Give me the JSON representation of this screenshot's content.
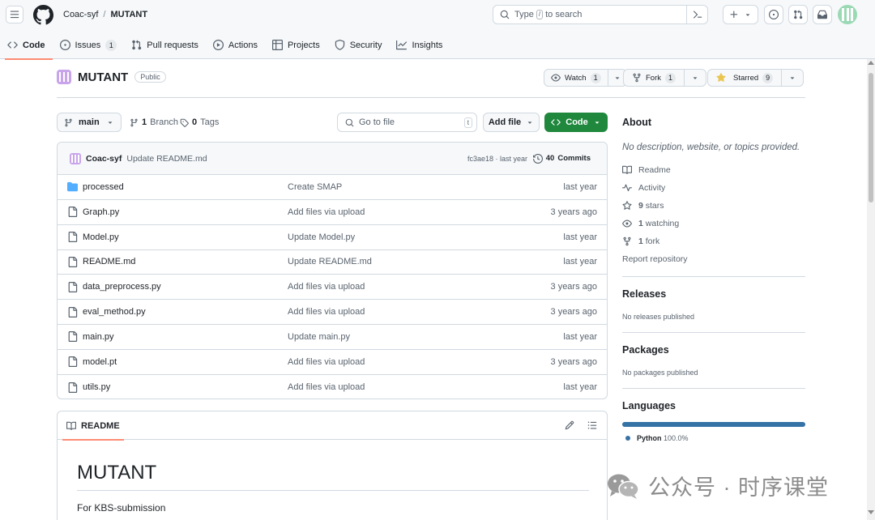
{
  "header": {
    "owner": "Coac-syf",
    "separator": "/",
    "repo": "MUTANT",
    "search_placeholder": "to search",
    "search_prefix": "Type",
    "search_kbd": "/"
  },
  "tabs": [
    {
      "label": "Code",
      "icon": "code-icon"
    },
    {
      "label": "Issues",
      "icon": "issue-icon",
      "count": "1"
    },
    {
      "label": "Pull requests",
      "icon": "pull-request-icon"
    },
    {
      "label": "Actions",
      "icon": "play-icon"
    },
    {
      "label": "Projects",
      "icon": "table-icon"
    },
    {
      "label": "Security",
      "icon": "shield-icon"
    },
    {
      "label": "Insights",
      "icon": "graph-icon"
    }
  ],
  "repo": {
    "name": "MUTANT",
    "visibility": "Public",
    "watch_label": "Watch",
    "watch_count": "1",
    "fork_label": "Fork",
    "fork_count": "1",
    "star_label": "Starred",
    "star_count": "9"
  },
  "toolbar": {
    "branch": "main",
    "branches_count": "1",
    "branches_label": "Branch",
    "tags_count": "0",
    "tags_label": "Tags",
    "goto_placeholder": "Go to file",
    "goto_kbd": "t",
    "add_file": "Add file",
    "code_button": "Code"
  },
  "latest_commit": {
    "author": "Coac-syf",
    "message": "Update README.md",
    "hash_time": "fc3ae18 · last year",
    "commits_count": "40",
    "commits_label": "Commits"
  },
  "files": [
    {
      "name": "processed",
      "type": "folder",
      "message": "Create SMAP",
      "date": "last year"
    },
    {
      "name": "Graph.py",
      "type": "file",
      "message": "Add files via upload",
      "date": "3 years ago"
    },
    {
      "name": "Model.py",
      "type": "file",
      "message": "Update Model.py",
      "date": "last year"
    },
    {
      "name": "README.md",
      "type": "file",
      "message": "Update README.md",
      "date": "last year"
    },
    {
      "name": "data_preprocess.py",
      "type": "file",
      "message": "Add files via upload",
      "date": "3 years ago"
    },
    {
      "name": "eval_method.py",
      "type": "file",
      "message": "Add files via upload",
      "date": "3 years ago"
    },
    {
      "name": "main.py",
      "type": "file",
      "message": "Update main.py",
      "date": "last year"
    },
    {
      "name": "model.pt",
      "type": "file",
      "message": "Add files via upload",
      "date": "3 years ago"
    },
    {
      "name": "utils.py",
      "type": "file",
      "message": "Add files via upload",
      "date": "last year"
    }
  ],
  "readme": {
    "tab_label": "README",
    "heading": "MUTANT",
    "paragraph": "For KBS-submission"
  },
  "about": {
    "title": "About",
    "description": "No description, website, or topics provided.",
    "readme_link": "Readme",
    "activity_link": "Activity",
    "stars_count": "9",
    "stars_label": "stars",
    "watching_count": "1",
    "watching_label": "watching",
    "fork_count": "1",
    "fork_label": "fork",
    "report": "Report repository"
  },
  "releases": {
    "title": "Releases",
    "text": "No releases published"
  },
  "packages": {
    "title": "Packages",
    "text": "No packages published"
  },
  "languages": {
    "title": "Languages",
    "items": [
      {
        "name": "Python",
        "percent": "100.0%",
        "color": "#3572a5",
        "share": 1.0
      }
    ]
  },
  "watermark": {
    "text": "公众号 · 时序课堂"
  },
  "colors": {
    "accent": "#1f883d",
    "tab_underline": "#fd8c73",
    "python": "#3572a5"
  }
}
